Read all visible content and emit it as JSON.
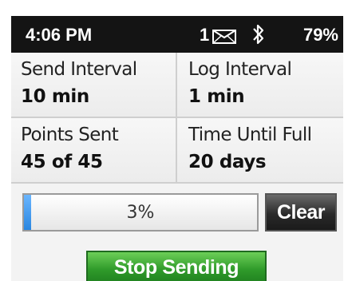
{
  "status_bar": {
    "time": "4:06 PM",
    "message_count": "1",
    "message_icon": "envelope-icon",
    "bluetooth_icon": "bluetooth-icon",
    "battery": "79%"
  },
  "info": {
    "send_interval": {
      "label": "Send Interval",
      "value": "10 min"
    },
    "log_interval": {
      "label": "Log Interval",
      "value": "1 min"
    },
    "points_sent": {
      "label": "Points Sent",
      "value": "45 of 45"
    },
    "time_until_full": {
      "label": "Time Until Full",
      "value": "20 days"
    }
  },
  "progress": {
    "label": "3%",
    "fraction": 0.03,
    "fill_color": "#3d95ee"
  },
  "buttons": {
    "clear": "Clear",
    "stop_sending": "Stop Sending",
    "stop_color": "#2f9a2a"
  }
}
